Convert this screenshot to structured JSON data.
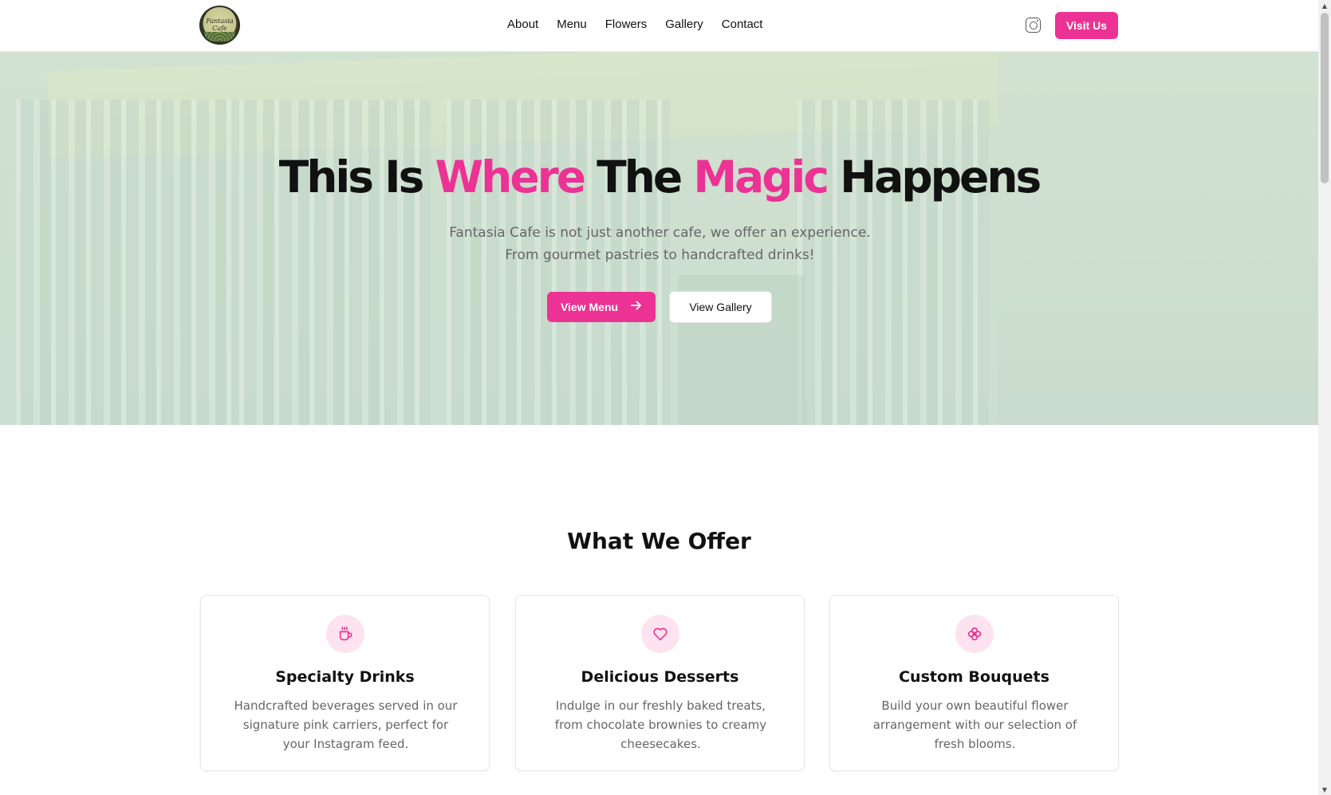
{
  "header": {
    "logo_text": "Fantasia Cafe",
    "nav": [
      "About",
      "Menu",
      "Flowers",
      "Gallery",
      "Contact"
    ],
    "instagram_icon": "instagram-icon",
    "visit_label": "Visit Us"
  },
  "hero": {
    "title": {
      "w1": "This Is ",
      "w2": "Where",
      "w3": " The ",
      "w4": "Magic",
      "w5": " Happens"
    },
    "subtitle": "Fantasia Cafe is not just another cafe, we offer an experience. From gourmet pastries to handcrafted drinks!",
    "menu_button": "View Menu",
    "menu_button_icon": "arrow-right-icon",
    "gallery_button": "View Gallery"
  },
  "offer": {
    "title": "What We Offer",
    "cards": [
      {
        "icon": "coffee-cup-icon",
        "title": "Specialty Drinks",
        "text": "Handcrafted beverages served in our signature pink carriers, perfect for your Instagram feed."
      },
      {
        "icon": "heart-icon",
        "title": "Delicious Desserts",
        "text": "Indulge in our freshly baked treats, from chocolate brownies to creamy cheesecakes."
      },
      {
        "icon": "flower-icon",
        "title": "Custom Bouquets",
        "text": "Build your own beautiful flower arrangement with our selection of fresh blooms."
      }
    ]
  },
  "colors": {
    "accent": "#ec3294",
    "accent_light": "#fde3ef",
    "text": "#111111",
    "muted": "#666666"
  }
}
